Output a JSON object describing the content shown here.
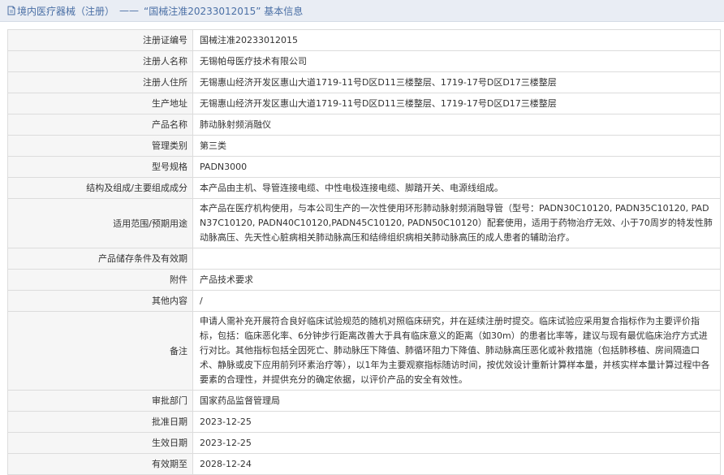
{
  "header": {
    "icon": "document-icon",
    "section": "境内医疗器械（注册）",
    "separator": "——",
    "title": "“国械注准20233012015” 基本信息",
    "color": "#4a6fa5"
  },
  "rows": [
    {
      "label": "注册证编号",
      "value": "国械注准20233012015"
    },
    {
      "label": "注册人名称",
      "value": "无锡帕母医疗技术有限公司"
    },
    {
      "label": "注册人住所",
      "value": "无锡惠山经济开发区惠山大道1719-11号D区D11三楼整层、1719-17号D区D17三楼整层"
    },
    {
      "label": "生产地址",
      "value": "无锡惠山经济开发区惠山大道1719-11号D区D11三楼整层、1719-17号D区D17三楼整层"
    },
    {
      "label": "产品名称",
      "value": "肺动脉射频消融仪"
    },
    {
      "label": "管理类别",
      "value": "第三类"
    },
    {
      "label": "型号规格",
      "value": "PADN3000"
    },
    {
      "label": "结构及组成/主要组成成分",
      "value": "本产品由主机、导管连接电缆、中性电极连接电缆、脚踏开关、电源线组成。"
    },
    {
      "label": "适用范围/预期用途",
      "value": "本产品在医疗机构使用，与本公司生产的一次性使用环形肺动脉射频消融导管（型号：PADN30C10120, PADN35C10120, PADN37C10120, PADN40C10120,PADN45C10120, PADN50C10120）配套使用，适用于药物治疗无效、小于70周岁的特发性肺动脉高压、先天性心脏病相关肺动脉高压和结缔组织病相关肺动脉高压的成人患者的辅助治疗。"
    },
    {
      "label": "产品储存条件及有效期",
      "value": ""
    },
    {
      "label": "附件",
      "value": "产品技术要求"
    },
    {
      "label": "其他内容",
      "value": "/"
    },
    {
      "label": "备注",
      "value": "申请人需补充开展符合良好临床试验规范的随机对照临床研究，并在延续注册时提交。临床试验应采用复合指标作为主要评价指标，包括：临床恶化率、6分钟步行距离改善大于具有临床意义的距离（如30m）的患者比率等，建议与现有最优临床治疗方式进行对比。其他指标包括全因死亡、肺动脉压下降值、肺循环阻力下降值、肺动脉高压恶化或补救措施（包括肺移植、房间隔造口术、静脉或皮下应用前列环素治疗等），以1年为主要观察指标随访时间，按优效设计重新计算样本量，并核实样本量计算过程中各要素的合理性，并提供充分的确定依据，以评价产品的安全有效性。"
    },
    {
      "label": "审批部门",
      "value": "国家药品监督管理局"
    },
    {
      "label": "批准日期",
      "value": "2023-12-25"
    },
    {
      "label": "生效日期",
      "value": "2023-12-25"
    },
    {
      "label": "有效期至",
      "value": "2028-12-24"
    }
  ]
}
